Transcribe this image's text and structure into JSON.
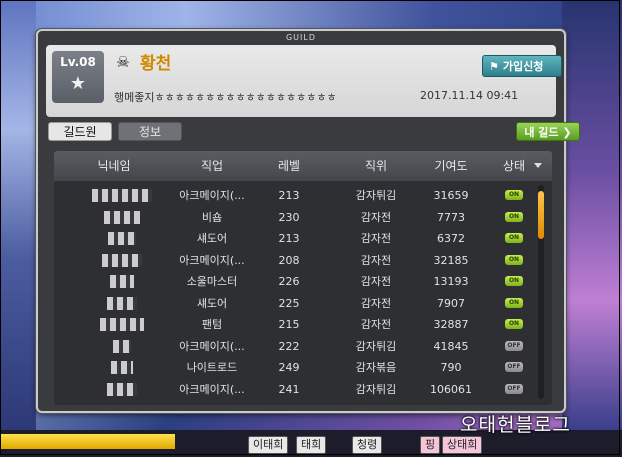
{
  "window": {
    "title": "GUILD"
  },
  "guild": {
    "level": "Lv.08",
    "name": "황천",
    "notice": "행메좋지ㅎㅎㅎㅎㅎㅎㅎㅎㅎㅎㅎㅎㅎㅎㅎㅎㅎㅎ",
    "date": "2017.11.14 09:41",
    "join_button_label": "가입신청"
  },
  "tabs": [
    {
      "label": "길드원",
      "active": true
    },
    {
      "label": "정보",
      "active": false
    }
  ],
  "my_guild_button_label": "내 길드",
  "table": {
    "headers": [
      "닉네임",
      "직업",
      "레벨",
      "직위",
      "기여도",
      "상태"
    ],
    "rows": [
      {
        "job": "아크메이지(...",
        "level": "213",
        "rank": "감자튀김",
        "contribution": "31659",
        "status": "ON"
      },
      {
        "job": "비숍",
        "level": "230",
        "rank": "감자전",
        "contribution": "7773",
        "status": "ON"
      },
      {
        "job": "섀도어",
        "level": "213",
        "rank": "감자전",
        "contribution": "6372",
        "status": "ON"
      },
      {
        "job": "아크메이지(...",
        "level": "208",
        "rank": "감자전",
        "contribution": "32185",
        "status": "ON"
      },
      {
        "job": "소울마스터",
        "level": "226",
        "rank": "감자전",
        "contribution": "13193",
        "status": "ON"
      },
      {
        "job": "섀도어",
        "level": "225",
        "rank": "감자전",
        "contribution": "7907",
        "status": "ON"
      },
      {
        "job": "팬텀",
        "level": "215",
        "rank": "감자전",
        "contribution": "32887",
        "status": "ON"
      },
      {
        "job": "아크메이지(...",
        "level": "222",
        "rank": "감자튀김",
        "contribution": "41845",
        "status": "OFF"
      },
      {
        "job": "나이트로드",
        "level": "249",
        "rank": "감자볶음",
        "contribution": "790",
        "status": "OFF"
      },
      {
        "job": "아크메이지(...",
        "level": "241",
        "rank": "감자튀김",
        "contribution": "106061",
        "status": "OFF"
      }
    ]
  },
  "hud": {
    "chip1": "이태희",
    "chip2": "태희",
    "chip3": "청령",
    "chip4": "핑",
    "chip5": "상태희"
  },
  "watermark": "오태헌블로그",
  "colors": {
    "accent_gold": "#d08a00",
    "join_button": "#2f7f8c",
    "my_guild_button": "#5b9d1f",
    "status_on": "#7fb21b",
    "status_off": "#8a8a8a",
    "scroll_thumb": "#e08a00"
  }
}
